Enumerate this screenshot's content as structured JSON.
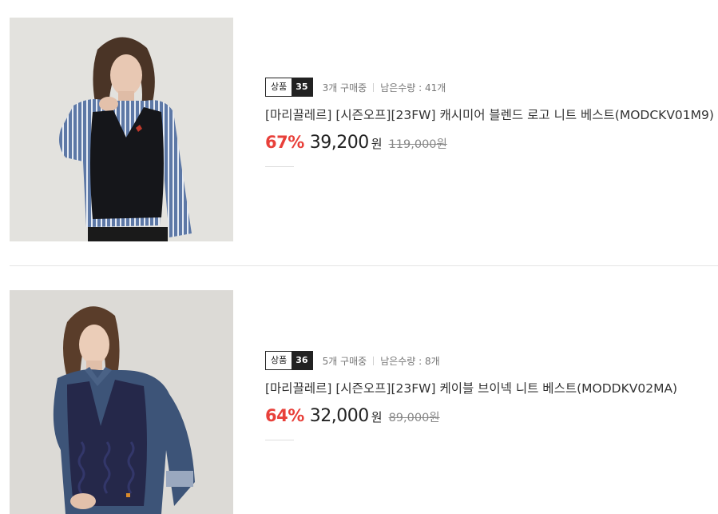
{
  "products": [
    {
      "badge_label": "상품",
      "badge_number": "35",
      "buying": "3개 구매중",
      "remaining": "남은수량 : 41개",
      "title": "[마리끌레르] [시즌오프][23FW] 캐시미어 블렌드 로고 니트 베스트(MODCKV01M9)",
      "discount": "67%",
      "price": "39,200",
      "currency": "원",
      "original_price": "119,000원"
    },
    {
      "badge_label": "상품",
      "badge_number": "36",
      "buying": "5개 구매중",
      "remaining": "남은수량 : 8개",
      "title": "[마리끌레르] [시즌오프][23FW] 케이블 브이넥 니트 베스트(MODDKV02MA)",
      "discount": "64%",
      "price": "32,000",
      "currency": "원",
      "original_price": "89,000원"
    }
  ],
  "colors": {
    "discount": "#e8403a",
    "badge_dark": "#222222"
  }
}
